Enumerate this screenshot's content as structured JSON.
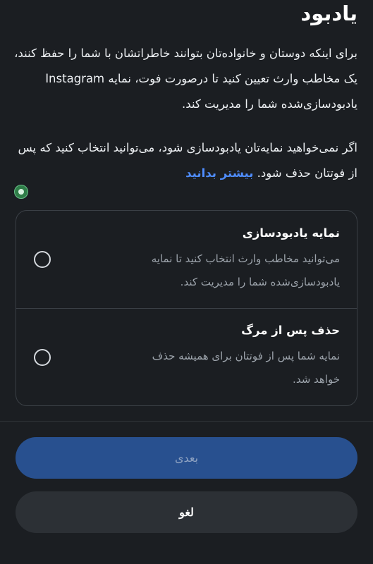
{
  "header": {
    "title": "یادبود"
  },
  "intro": {
    "paragraph": "برای اینکه دوستان و خانواده‌تان بتوانند خاطراتشان با شما را حفظ کنند، یک مخاطب وارث تعیین کنید تا درصورت فوت، نمایه Instagram یادبودسازی‌شده شما را مدیریت کند."
  },
  "delete_info": {
    "text": "اگر نمی‌خواهید نمایه‌تان یادبودسازی شود، می‌توانید انتخاب کنید که پس از فوتتان حذف شود.",
    "learn_more": "بیشتر بدانید"
  },
  "options": [
    {
      "title": "نمایه یادبودسازی",
      "description": "می‌توانید مخاطب وارث انتخاب کنید تا نمایه یادبودسازی‌شده شما را مدیریت کند.",
      "selected": false
    },
    {
      "title": "حذف پس از مرگ",
      "description": "نمایه شما پس از فوتتان برای همیشه حذف خواهد شد.",
      "selected": false
    }
  ],
  "actions": {
    "next_label": "بعدی",
    "next_enabled": false,
    "cancel_label": "لغو"
  },
  "colors": {
    "background": "#1b1e22",
    "accent_link": "#4f8dff",
    "primary_button_disabled": "#28508f",
    "secondary_button": "#2c3035"
  }
}
